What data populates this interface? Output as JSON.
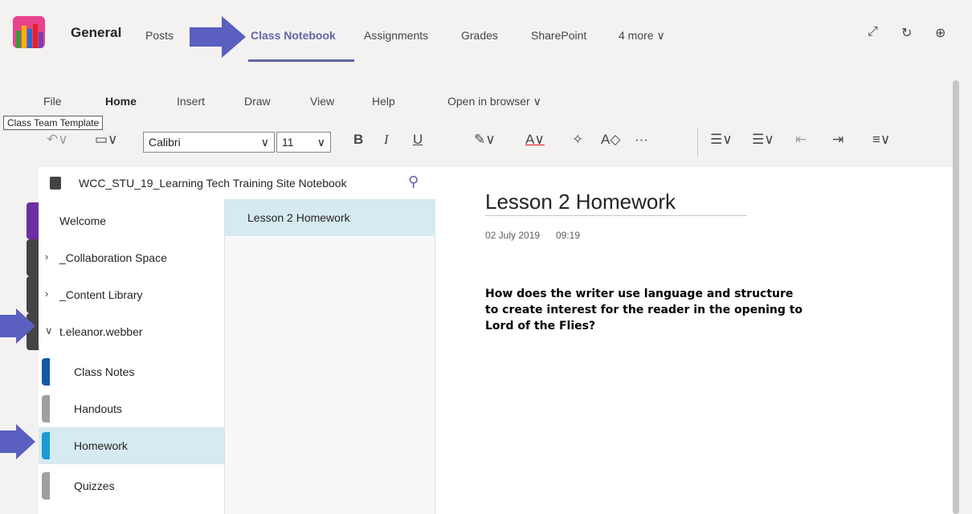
{
  "header": {
    "team_name": "General",
    "tabs": [
      {
        "label": "Posts"
      },
      {
        "label": "Class Notebook"
      },
      {
        "label": "Assignments"
      },
      {
        "label": "Grades"
      },
      {
        "label": "SharePoint"
      },
      {
        "label": "4 more ∨"
      }
    ]
  },
  "ribbon": {
    "menu": [
      "File",
      "Home",
      "Insert",
      "Draw",
      "View",
      "Help",
      "Open in browser ∨"
    ],
    "tooltip": "Class Team Template",
    "font_name": "Calibri",
    "font_size": "11"
  },
  "notebook": {
    "title": "WCC_STU_19_Learning Tech Training Site Notebook",
    "sections": [
      {
        "label": "Welcome"
      },
      {
        "label": "_Collaboration Space"
      },
      {
        "label": "_Content Library"
      },
      {
        "label": "t.eleanor.webber"
      },
      {
        "label": "Class Notes"
      },
      {
        "label": "Handouts"
      },
      {
        "label": "Homework"
      },
      {
        "label": "Quizzes"
      }
    ],
    "pages": [
      {
        "label": "Lesson 2 Homework"
      }
    ]
  },
  "page": {
    "title": "Lesson 2 Homework",
    "date": "02 July 2019",
    "time": "09:19",
    "body": "How does the writer use language and structure to create interest for the reader in the opening to Lord of the Flies?"
  },
  "colors": {
    "accent": "#6264a7",
    "selected": "#d6eaf2",
    "arrow": "#5a5fc0"
  }
}
